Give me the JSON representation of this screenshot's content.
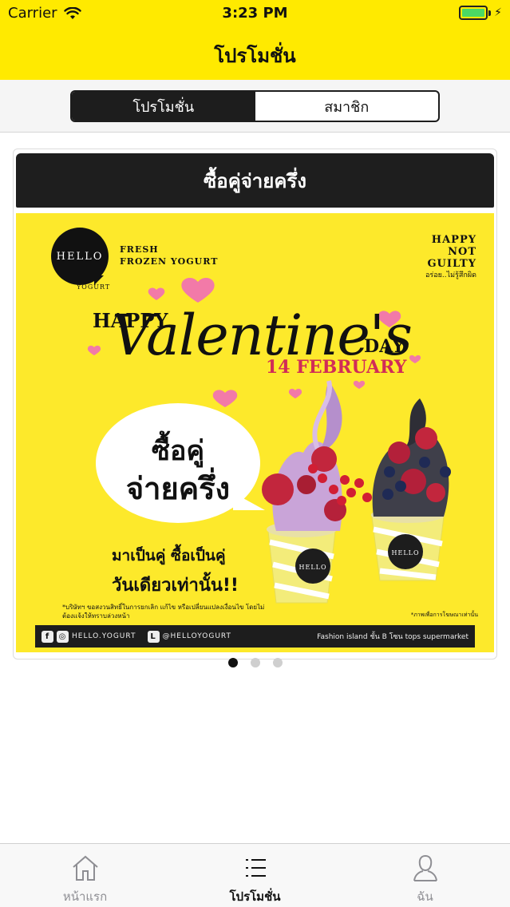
{
  "status": {
    "carrier": "Carrier",
    "time": "3:23 PM",
    "battery_level": 1.0,
    "battery_color": "#4cd964"
  },
  "nav": {
    "title": "โปรโมชั่น"
  },
  "segments": {
    "items": [
      "โปรโมชั่น",
      "สมาชิก"
    ],
    "selected": 0
  },
  "promotion": {
    "title": "ซื้อคู่จ่ายครึ่ง",
    "image": {
      "logo": "HELLO",
      "logo_sub": "YOGURT",
      "tagline": [
        "FRESH",
        "FROZEN YOGURT"
      ],
      "slogan": [
        "HAPPY",
        "NOT",
        "GUILTY"
      ],
      "slogan_th": "อร่อย..ไม่รู้สึกผิด",
      "happy": "HAPPY",
      "valentine": "Valentine's",
      "day": "DAY",
      "date": "14 FEBRUARY",
      "bubble_line1": "ซื้อคู่",
      "bubble_line2": "จ่ายครึ่ง",
      "tag1": "มาเป็นคู่ ซื้อเป็นคู่",
      "tag2": "วันเดียวเท่านั้น!!",
      "fine_print": "*บริษัทฯ ขอสงวนสิทธิ์ในการยกเลิก แก้ไข หรือเปลี่ยนแปลงเงื่อนไข โดยไม่ต้องแจ้งให้ทราบล่วงหน้า",
      "fine_print_right": "*ภาพเพื่อการโฆษณาเท่านั้น",
      "social_handle": "HELLO.YOGURT",
      "line_handle": "@HELLOYOGURT",
      "location": "Fashion island ชั้น B โซน tops supermarket"
    }
  },
  "carousel": {
    "pages": 3,
    "current": 0
  },
  "tabbar": {
    "items": [
      {
        "label": "หน้าแรก",
        "icon": "home-icon"
      },
      {
        "label": "โปรโมชั่น",
        "icon": "list-icon"
      },
      {
        "label": "ฉัน",
        "icon": "user-icon"
      }
    ],
    "selected": 1
  },
  "colors": {
    "brand_yellow": "#ffea00",
    "dark": "#1d1d1d",
    "accent_pink": "#d12c57"
  }
}
